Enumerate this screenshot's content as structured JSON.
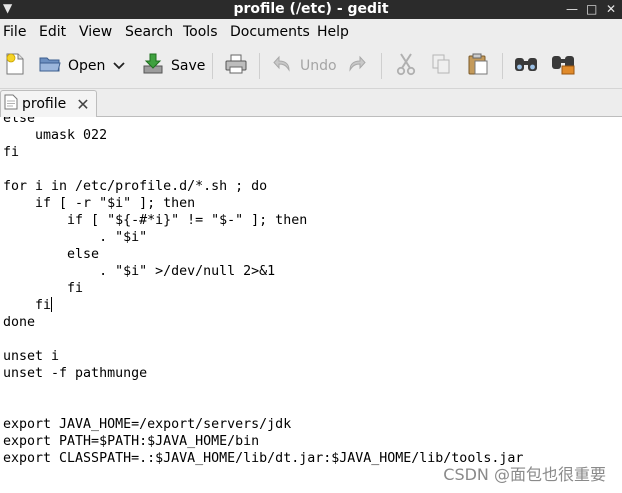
{
  "window": {
    "title": "profile (/etc) - gedit",
    "menu_glyph": "▼",
    "minimize_glyph": "—",
    "maximize_glyph": "□",
    "close_glyph": "✕"
  },
  "menubar": {
    "items": [
      "File",
      "Edit",
      "View",
      "Search",
      "Tools",
      "Documents",
      "Help"
    ]
  },
  "toolbar": {
    "new_icon": "new-document-icon",
    "open_label": "Open",
    "open_dropdown_glyph": "⌄",
    "save_label": "Save",
    "print_icon": "print-icon",
    "undo_label": "Undo",
    "redo_icon": "redo-icon",
    "cut_icon": "cut-icon",
    "copy_icon": "copy-icon",
    "paste_icon": "paste-icon",
    "find_icon": "find-icon",
    "replace_icon": "find-replace-icon"
  },
  "tabs": [
    {
      "label": "profile",
      "close_glyph": "✕"
    }
  ],
  "editor": {
    "lines": [
      "else",
      "    umask 022",
      "fi",
      "",
      "for i in /etc/profile.d/*.sh ; do",
      "    if [ -r \"$i\" ]; then",
      "        if [ \"${-#*i}\" != \"$-\" ]; then",
      "            . \"$i\"",
      "        else",
      "            . \"$i\" >/dev/null 2>&1",
      "        fi",
      "    fi",
      "done",
      "",
      "unset i",
      "unset -f pathmunge",
      "",
      "",
      "export JAVA_HOME=/export/servers/jdk",
      "export PATH=$PATH:$JAVA_HOME/bin",
      "export CLASSPATH=.:$JAVA_HOME/lib/dt.jar:$JAVA_HOME/lib/tools.jar"
    ],
    "caret_line_index": 11
  },
  "watermark": "CSDN @面包也很重要"
}
